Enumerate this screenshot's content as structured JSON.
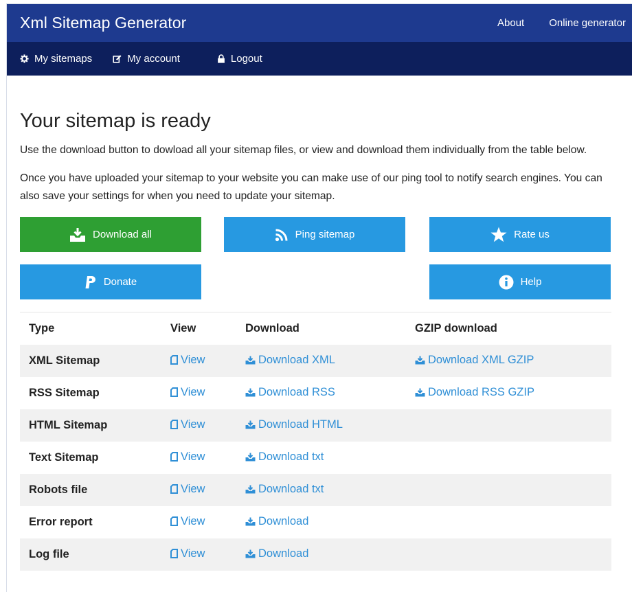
{
  "header": {
    "brand": "Xml Sitemap Generator",
    "nav": [
      "About",
      "Online generator"
    ]
  },
  "subnav": {
    "items": [
      {
        "label": "My sitemaps",
        "icon": "gear-icon"
      },
      {
        "label": "My account",
        "icon": "edit-icon"
      },
      {
        "label": "Logout",
        "icon": "lock-icon"
      }
    ]
  },
  "main": {
    "title": "Your sitemap is ready",
    "para1": "Use the download button to dowload all your sitemap files, or view and download them individually from the table below.",
    "para2": "Once you have uploaded your sitemap to your website you can make use of our ping tool to notify search engines. You can also save your settings for when you need to update your sitemap."
  },
  "buttons": {
    "download_all": "Download all",
    "ping": "Ping sitemap",
    "rate": "Rate us",
    "donate": "Donate",
    "help": "Help"
  },
  "table": {
    "headers": [
      "Type",
      "View",
      "Download",
      "GZIP download"
    ],
    "rows": [
      {
        "type": "XML Sitemap",
        "view": "View",
        "download": "Download XML",
        "gzip": "Download XML GZIP"
      },
      {
        "type": "RSS Sitemap",
        "view": "View",
        "download": "Download RSS",
        "gzip": "Download RSS GZIP"
      },
      {
        "type": "HTML Sitemap",
        "view": "View",
        "download": "Download HTML",
        "gzip": ""
      },
      {
        "type": "Text Sitemap",
        "view": "View",
        "download": "Download txt",
        "gzip": ""
      },
      {
        "type": "Robots file",
        "view": "View",
        "download": "Download txt",
        "gzip": ""
      },
      {
        "type": "Error report",
        "view": "View",
        "download": "Download",
        "gzip": ""
      },
      {
        "type": "Log file",
        "view": "View",
        "download": "Download",
        "gzip": ""
      }
    ]
  },
  "colors": {
    "topbar": "#1e3a8f",
    "subbar": "#0d1f5c",
    "green": "#2e9f33",
    "blue": "#2799e1",
    "link": "#2f8fd6"
  }
}
